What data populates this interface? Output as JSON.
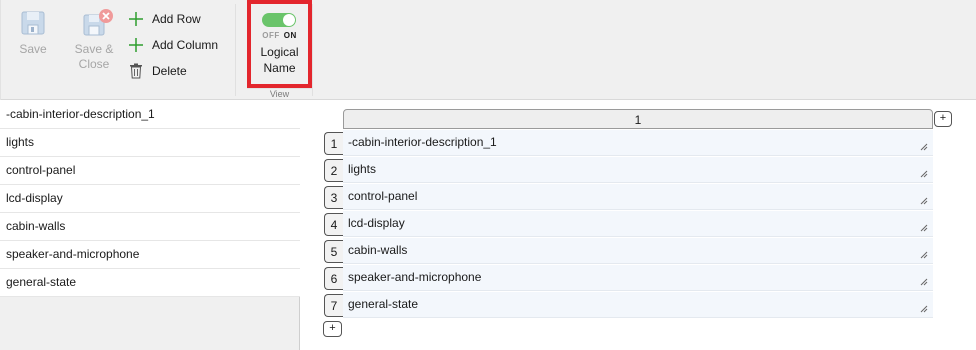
{
  "toolbar": {
    "save_label": "Save",
    "save_close_label": "Save &\nClose",
    "add_row_label": "Add Row",
    "add_column_label": "Add Column",
    "delete_label": "Delete"
  },
  "view_group": {
    "toggle_off_label": "OFF",
    "toggle_on_label": "ON",
    "toggle_state": "on",
    "logical_name_label": "Logical\nName",
    "group_label": "View"
  },
  "left_list": {
    "items": [
      "-cabin-interior-description_1",
      "lights",
      "control-panel",
      "lcd-display",
      "cabin-walls",
      "speaker-and-microphone",
      "general-state"
    ]
  },
  "grid": {
    "column_header": "1",
    "add_column_symbol": "+",
    "add_row_symbol": "+",
    "rows": [
      {
        "num": "1",
        "value": "-cabin-interior-description_1"
      },
      {
        "num": "2",
        "value": "lights"
      },
      {
        "num": "3",
        "value": "control-panel"
      },
      {
        "num": "4",
        "value": "lcd-display"
      },
      {
        "num": "5",
        "value": "cabin-walls"
      },
      {
        "num": "6",
        "value": "speaker-and-microphone"
      },
      {
        "num": "7",
        "value": "general-state"
      }
    ]
  },
  "colors": {
    "toggle_on": "#6ac46a",
    "highlight": "#e3262d",
    "ribbon_bg": "#f0f0f0",
    "add_icon": "#2e9e2e"
  }
}
